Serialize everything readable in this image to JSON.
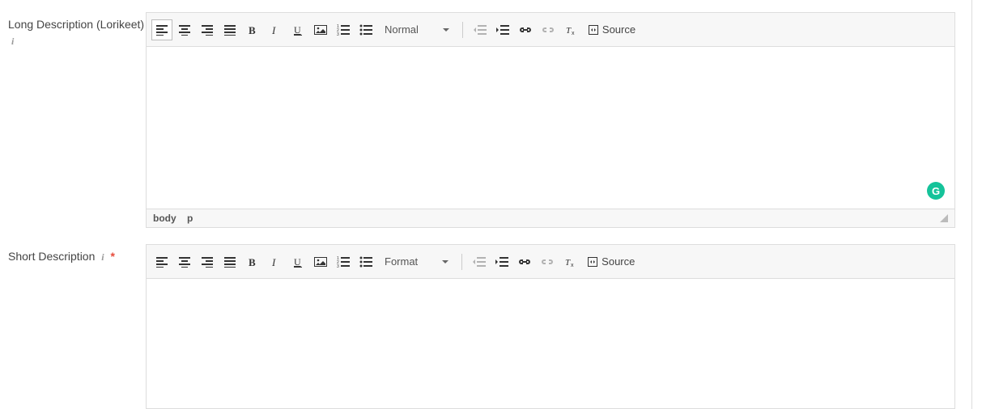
{
  "fields": {
    "long_desc": {
      "label": "Long Description (Lorikeet)",
      "format_label": "Normal",
      "source_label": "Source",
      "path": [
        "body",
        "p"
      ]
    },
    "short_desc": {
      "label": "Short Description",
      "format_label": "Format",
      "source_label": "Source"
    }
  },
  "icons": {
    "info": "i",
    "required": "*",
    "grammarly": "G"
  }
}
